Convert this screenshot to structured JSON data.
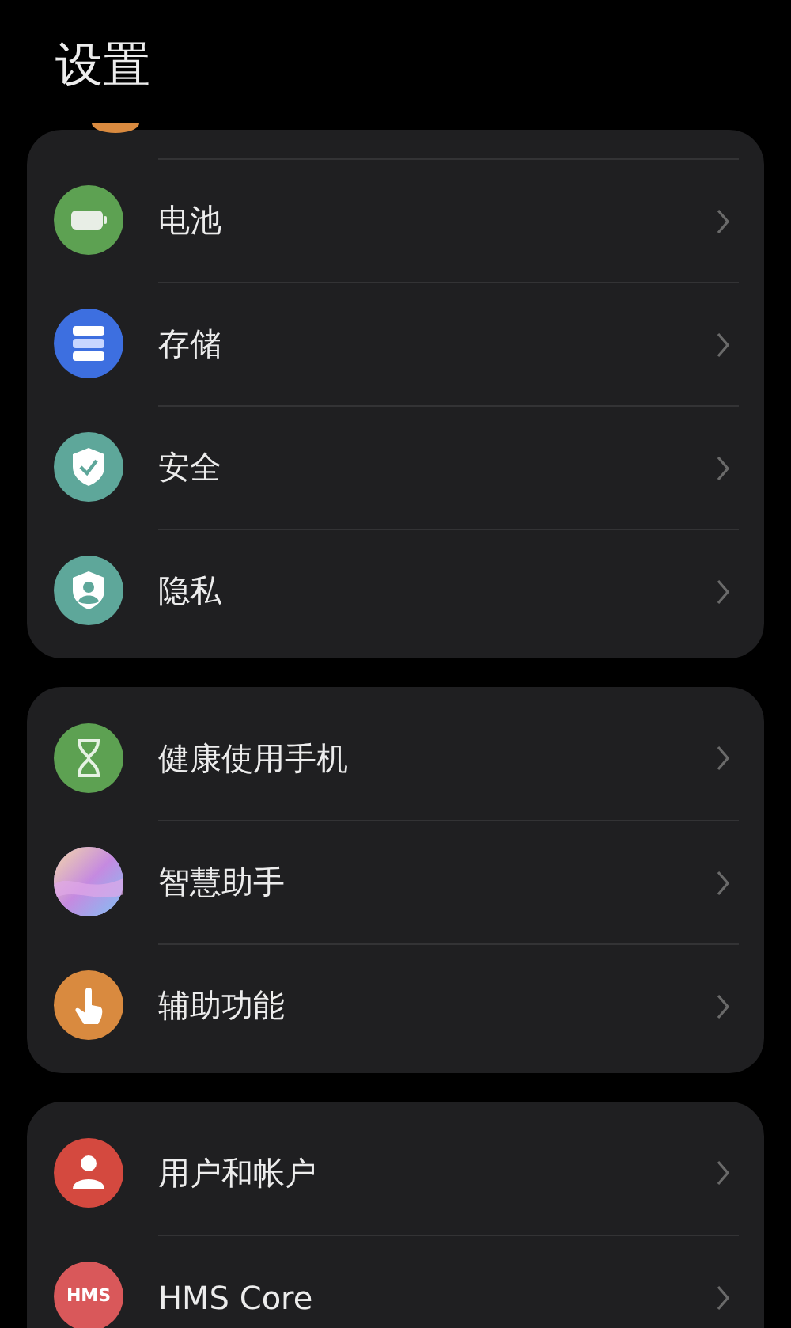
{
  "title": "设置",
  "groups": [
    {
      "items": [
        {
          "label": "电池",
          "color": "#5da152"
        },
        {
          "label": "存储",
          "color": "#3d6fe0"
        },
        {
          "label": "安全",
          "color": "#5ea79a"
        },
        {
          "label": "隐私",
          "color": "#5ea79a"
        }
      ]
    },
    {
      "items": [
        {
          "label": "健康使用手机",
          "color": "#5da152"
        },
        {
          "label": "智慧助手",
          "color": "#b89ce8"
        },
        {
          "label": "辅助功能",
          "color": "#d98a3f"
        }
      ]
    },
    {
      "items": [
        {
          "label": "用户和帐户",
          "color": "#d4493f"
        },
        {
          "label": "HMS Core",
          "color": "#d9585a",
          "icon_text": "HMS"
        }
      ]
    }
  ]
}
